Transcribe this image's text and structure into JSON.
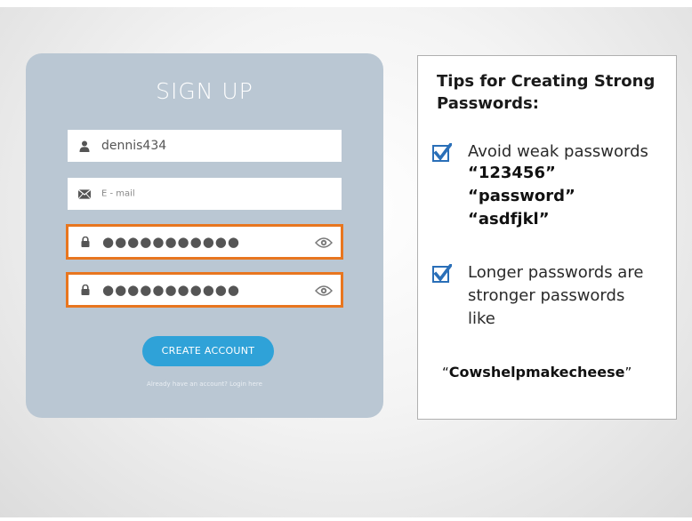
{
  "signup": {
    "title": "SIGN UP",
    "username_value": "dennis434",
    "email_placeholder": "E - mail",
    "password_mask": "●●●●●●●●●●●",
    "confirm_password_mask": "●●●●●●●●●●●",
    "create_button": "CREATE ACCOUNT",
    "login_link": "Already have an account? Login here",
    "highlight_color": "#e8761f",
    "accent_color": "#2fa2d8",
    "card_color": "#bac7d3",
    "icons": [
      "user-icon",
      "envelope-icon",
      "lock-icon",
      "eye-icon"
    ]
  },
  "tips": {
    "heading_line1": "Tips for Creating Strong",
    "heading_line2": "Passwords:",
    "tip1": {
      "text": "Avoid weak passwords",
      "examples": [
        "“123456”",
        "“password”",
        "“asdfjkl”"
      ]
    },
    "tip2": {
      "lines": [
        "Longer passwords are",
        "stronger passwords",
        "like"
      ]
    },
    "example_open": "“",
    "example_word": "Cowshelpmakecheese",
    "example_close": "”",
    "check_color": "#2a6fb8"
  }
}
